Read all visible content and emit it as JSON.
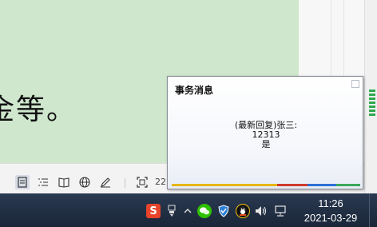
{
  "document": {
    "visible_text": "金等。"
  },
  "statusbar": {
    "icons": [
      "page-view-icon",
      "outline-icon",
      "reading-mode-icon",
      "web-view-icon",
      "pen-icon",
      "fullscreen-icon"
    ],
    "zoom": "22"
  },
  "notification": {
    "title": "事务消息",
    "line1": "(最新回复)张三:",
    "line2": "12313",
    "line3": "是",
    "strip_colors": [
      "#e6b800",
      "#d03a2c",
      "#2b6fd6",
      "#3da85a"
    ]
  },
  "taskbar": {
    "tray_icons": [
      "sogou-ime-icon",
      "usb-device-icon",
      "show-hidden-icons-chevron",
      "wechat-icon",
      "security-shield-icon",
      "qq-icon",
      "volume-icon",
      "network-icon"
    ],
    "time": "11:26",
    "date": "2021-03-29"
  }
}
